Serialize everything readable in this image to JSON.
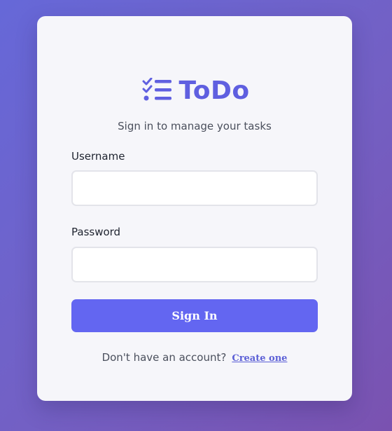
{
  "brand": {
    "title": "ToDo",
    "icon": "task-list-icon",
    "accent_color": "#5f5fe0"
  },
  "subtitle": "Sign in to manage your tasks",
  "form": {
    "username_label": "Username",
    "username_value": "",
    "password_label": "Password",
    "password_value": "",
    "submit_label": "Sign In",
    "button_color": "#6366f1"
  },
  "footer": {
    "prompt": "Don't have an account?",
    "link_label": "Create one"
  }
}
